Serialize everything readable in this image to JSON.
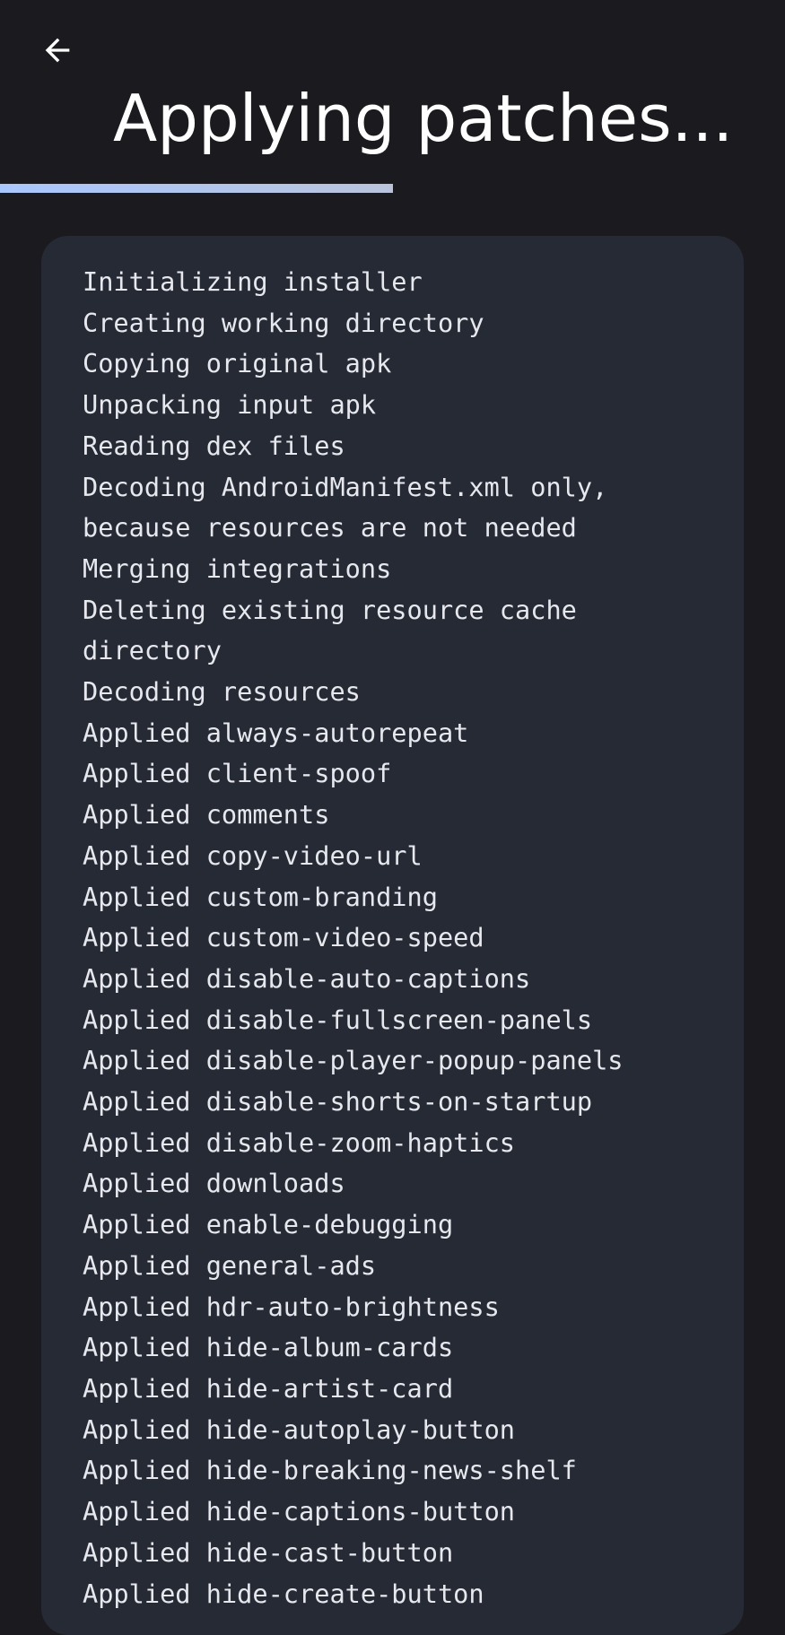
{
  "header": {
    "back_icon": "arrow-back-icon",
    "title": "Applying patches..."
  },
  "progress": {
    "value": 0.5,
    "color": "#a9c7ff"
  },
  "log": {
    "lines": [
      "Initializing installer",
      "Creating working directory",
      "Copying original apk",
      "Unpacking input apk",
      "Reading dex files",
      "Decoding AndroidManifest.xml only,",
      "because resources are not needed",
      "Merging integrations",
      "Deleting existing resource cache",
      "directory",
      "Decoding resources",
      "Applied always-autorepeat",
      "Applied client-spoof",
      "Applied comments",
      "Applied copy-video-url",
      "Applied custom-branding",
      "Applied custom-video-speed",
      "Applied disable-auto-captions",
      "Applied disable-fullscreen-panels",
      "Applied disable-player-popup-panels",
      "Applied disable-shorts-on-startup",
      "Applied disable-zoom-haptics",
      "Applied downloads",
      "Applied enable-debugging",
      "Applied general-ads",
      "Applied hdr-auto-brightness",
      "Applied hide-album-cards",
      "Applied hide-artist-card",
      "Applied hide-autoplay-button",
      "Applied hide-breaking-news-shelf",
      "Applied hide-captions-button",
      "Applied hide-cast-button",
      "Applied hide-create-button"
    ]
  }
}
